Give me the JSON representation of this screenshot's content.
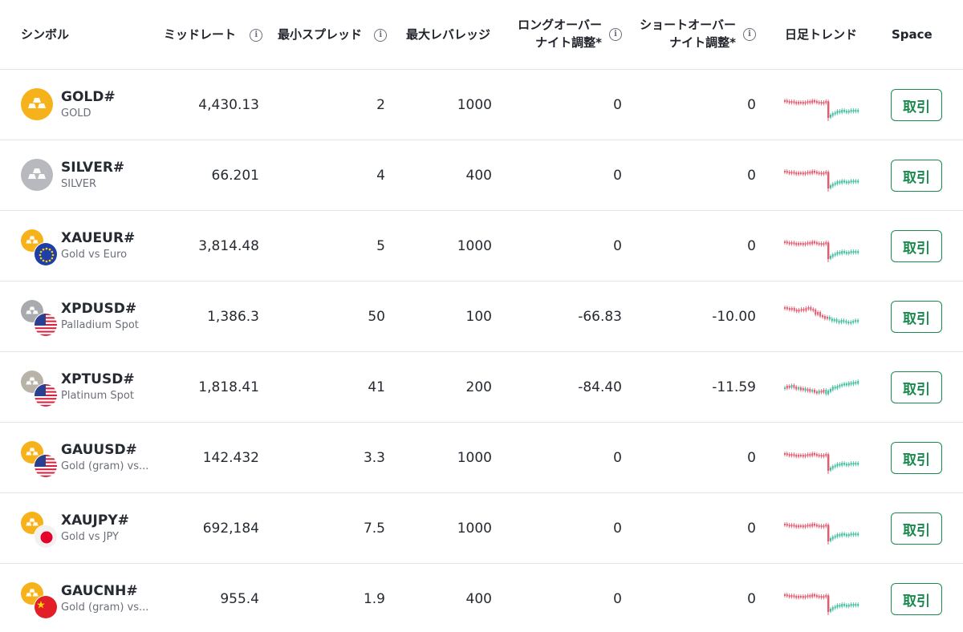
{
  "header": {
    "symbol": "シンボル",
    "mid_rate": "ミッドレート",
    "min_spread": "最小スプレッド",
    "max_leverage": "最大レバレッジ",
    "long_swap_line1": "ロングオーバー",
    "long_swap_line2": "ナイト調整*",
    "short_swap_line1": "ショートオーバー",
    "short_swap_line2": "ナイト調整*",
    "daily_trend": "日足トレンド",
    "space": "Space"
  },
  "colors": {
    "accent": "#1a8a4f",
    "gold": "#f6b21a",
    "silver": "#b8b9be",
    "candle_up": "#3fbf9f",
    "candle_down": "#e8596e"
  },
  "rows": [
    {
      "code": "GOLD#",
      "desc": "GOLD",
      "mid": "4,430.13",
      "spread": "2",
      "leverage": "1000",
      "long": "0",
      "short": "0",
      "trade": "取引",
      "metal": "gold",
      "flag": "none",
      "trend": "drop"
    },
    {
      "code": "SILVER#",
      "desc": "SILVER",
      "mid": "66.201",
      "spread": "4",
      "leverage": "400",
      "long": "0",
      "short": "0",
      "trade": "取引",
      "metal": "silver",
      "flag": "none",
      "trend": "drop"
    },
    {
      "code": "XAUEUR#",
      "desc": "Gold vs Euro",
      "mid": "3,814.48",
      "spread": "5",
      "leverage": "1000",
      "long": "0",
      "short": "0",
      "trade": "取引",
      "metal": "gold",
      "flag": "eu",
      "trend": "drop"
    },
    {
      "code": "XPDUSD#",
      "desc": "Palladium Spot",
      "mid": "1,386.3",
      "spread": "50",
      "leverage": "100",
      "long": "-66.83",
      "short": "-10.00",
      "trade": "取引",
      "metal": "palladium",
      "flag": "us",
      "trend": "decline"
    },
    {
      "code": "XPTUSD#",
      "desc": "Platinum Spot",
      "mid": "1,818.41",
      "spread": "41",
      "leverage": "200",
      "long": "-84.40",
      "short": "-11.59",
      "trade": "取引",
      "metal": "platinum",
      "flag": "us",
      "trend": "rise"
    },
    {
      "code": "GAUUSD#",
      "desc": "Gold (gram) vs...",
      "mid": "142.432",
      "spread": "3.3",
      "leverage": "1000",
      "long": "0",
      "short": "0",
      "trade": "取引",
      "metal": "gold",
      "flag": "us",
      "trend": "drop"
    },
    {
      "code": "XAUJPY#",
      "desc": "Gold vs JPY",
      "mid": "692,184",
      "spread": "7.5",
      "leverage": "1000",
      "long": "0",
      "short": "0",
      "trade": "取引",
      "metal": "gold",
      "flag": "jp",
      "trend": "drop"
    },
    {
      "code": "GAUCNH#",
      "desc": "Gold (gram) vs...",
      "mid": "955.4",
      "spread": "1.9",
      "leverage": "400",
      "long": "0",
      "short": "0",
      "trade": "取引",
      "metal": "gold",
      "flag": "cn",
      "trend": "drop"
    }
  ]
}
